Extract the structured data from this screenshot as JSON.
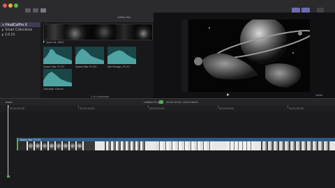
{
  "window": {
    "title": "—"
  },
  "toolbar": {
    "left_icons": [
      "media-icon",
      "photos-icon",
      "titles-icon",
      "import-icon"
    ],
    "zoom_label": "1080p 30p",
    "browser_title": "Untitled Project",
    "viewer_title": "Untitled Project",
    "right_buttons": [
      "Share",
      "Inspector"
    ]
  },
  "sidebar": {
    "items": [
      {
        "label": "FinalCutPro X",
        "selected": true
      },
      {
        "label": "Smart Collections",
        "selected": false
      },
      {
        "label": "2.8.19",
        "selected": false
      }
    ]
  },
  "browser": {
    "date_header": "June 15, 2021",
    "clips": [
      {
        "label": "Space Bar FX.01"
      },
      {
        "label": "Space Bar FX.02"
      },
      {
        "label": "Mid Range_FX.01"
      },
      {
        "label": "Gibraltar Theme"
      }
    ],
    "footer": "1 of 4 selected"
  },
  "viewer": {
    "zoom": "100%",
    "view": "View"
  },
  "timeline": {
    "index_label": "Index",
    "project_name": "Untitled Project",
    "duration": "00:00:10:00 / 00:01:58:00",
    "ruler_labels": [
      "00:00:00:00",
      "00:00:15:00",
      "00:00:30:00",
      "00:00:45:00",
      "00:01:00:00"
    ],
    "clip_label": "Space Bar FX.01"
  },
  "colors": {
    "accent": "#6c6cae",
    "clip_bg": "#1a4648",
    "clip_wave": "#4fa3a3",
    "track_top": "#2e5a86",
    "green_marker": "#4fae4f"
  }
}
